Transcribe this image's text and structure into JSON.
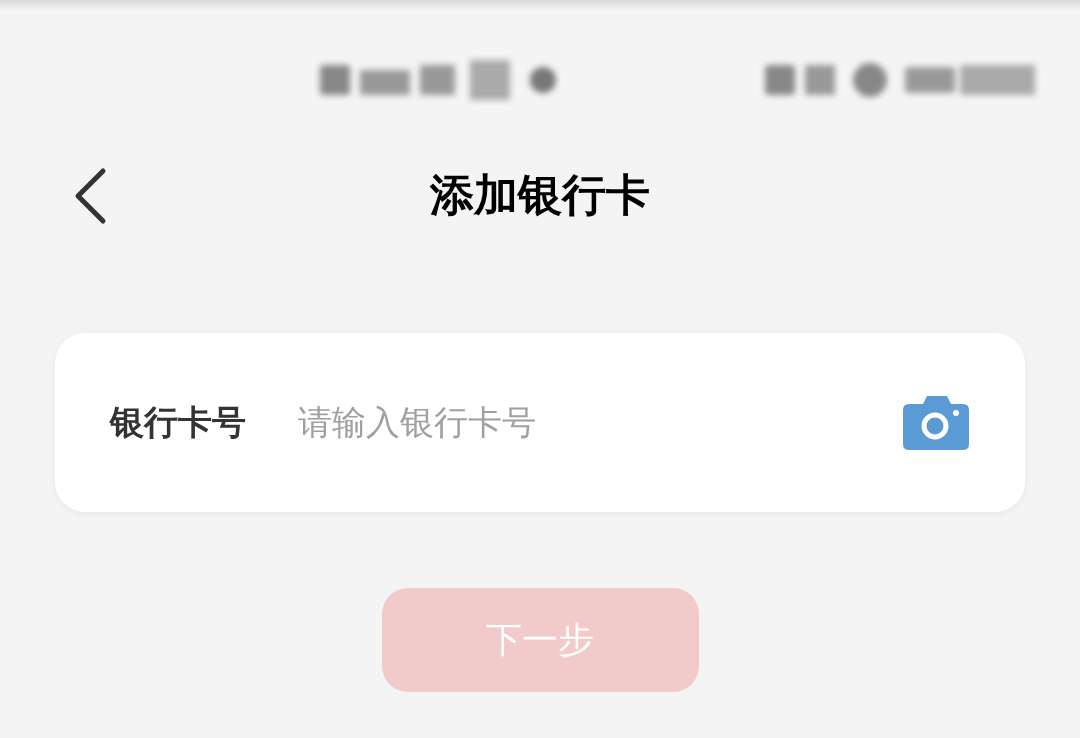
{
  "header": {
    "title": "添加银行卡"
  },
  "card_field": {
    "label": "银行卡号",
    "placeholder": "请输入银行卡号"
  },
  "next_button": {
    "label": "下一步",
    "disabled": true
  }
}
